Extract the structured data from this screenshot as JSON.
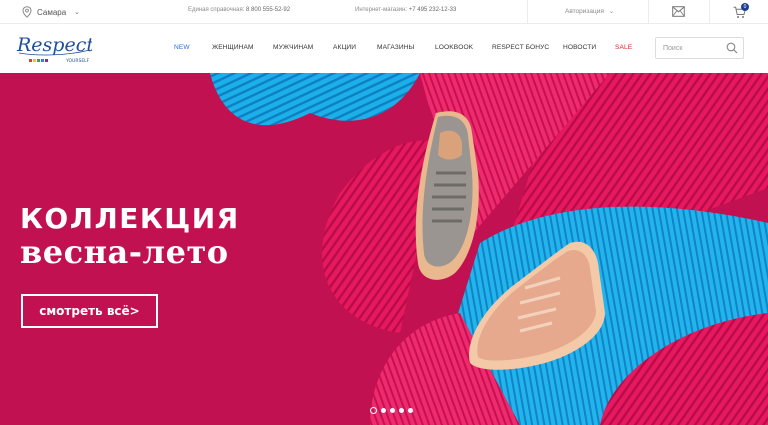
{
  "topbar": {
    "city": "Самара",
    "helpline_label": "Единая справочная:",
    "helpline_phone": "8 800 555-52-92",
    "shop_label": "Интернет-магазин:",
    "shop_phone": "+7 495 232-12-33",
    "auth_label": "Авторизация",
    "cart_count": "0",
    "icons": [
      "map-pin-icon",
      "chevron-down-icon",
      "mail-icon",
      "cart-icon"
    ]
  },
  "header": {
    "logo_text": "Respect",
    "logo_subtext": "YOURSELF",
    "nav": [
      {
        "label": "NEW",
        "color": "#2a6fd6"
      },
      {
        "label": "ЖЕНЩИНАМ",
        "color": "#333333"
      },
      {
        "label": "МУЖЧИНАМ",
        "color": "#333333"
      },
      {
        "label": "АКЦИИ",
        "color": "#333333"
      },
      {
        "label": "МАГАЗИНЫ",
        "color": "#333333"
      },
      {
        "label": "LOOKBOOK",
        "color": "#333333"
      },
      {
        "label": "RESPECT БОНУС",
        "color": "#333333"
      },
      {
        "label": "НОВОСТИ",
        "color": "#333333"
      },
      {
        "label": "SALE",
        "color": "#e0242a"
      }
    ],
    "search_placeholder": "Поиск"
  },
  "hero": {
    "line1": "КОЛЛЕКЦИЯ",
    "line2": "весна-лето",
    "cta_label": "смотреть всё>",
    "slides_total": 5,
    "active_slide": 1,
    "colors": {
      "background": "#c11150",
      "fan_blue": "#19a9e3",
      "fan_pink": "#e81b63"
    }
  }
}
